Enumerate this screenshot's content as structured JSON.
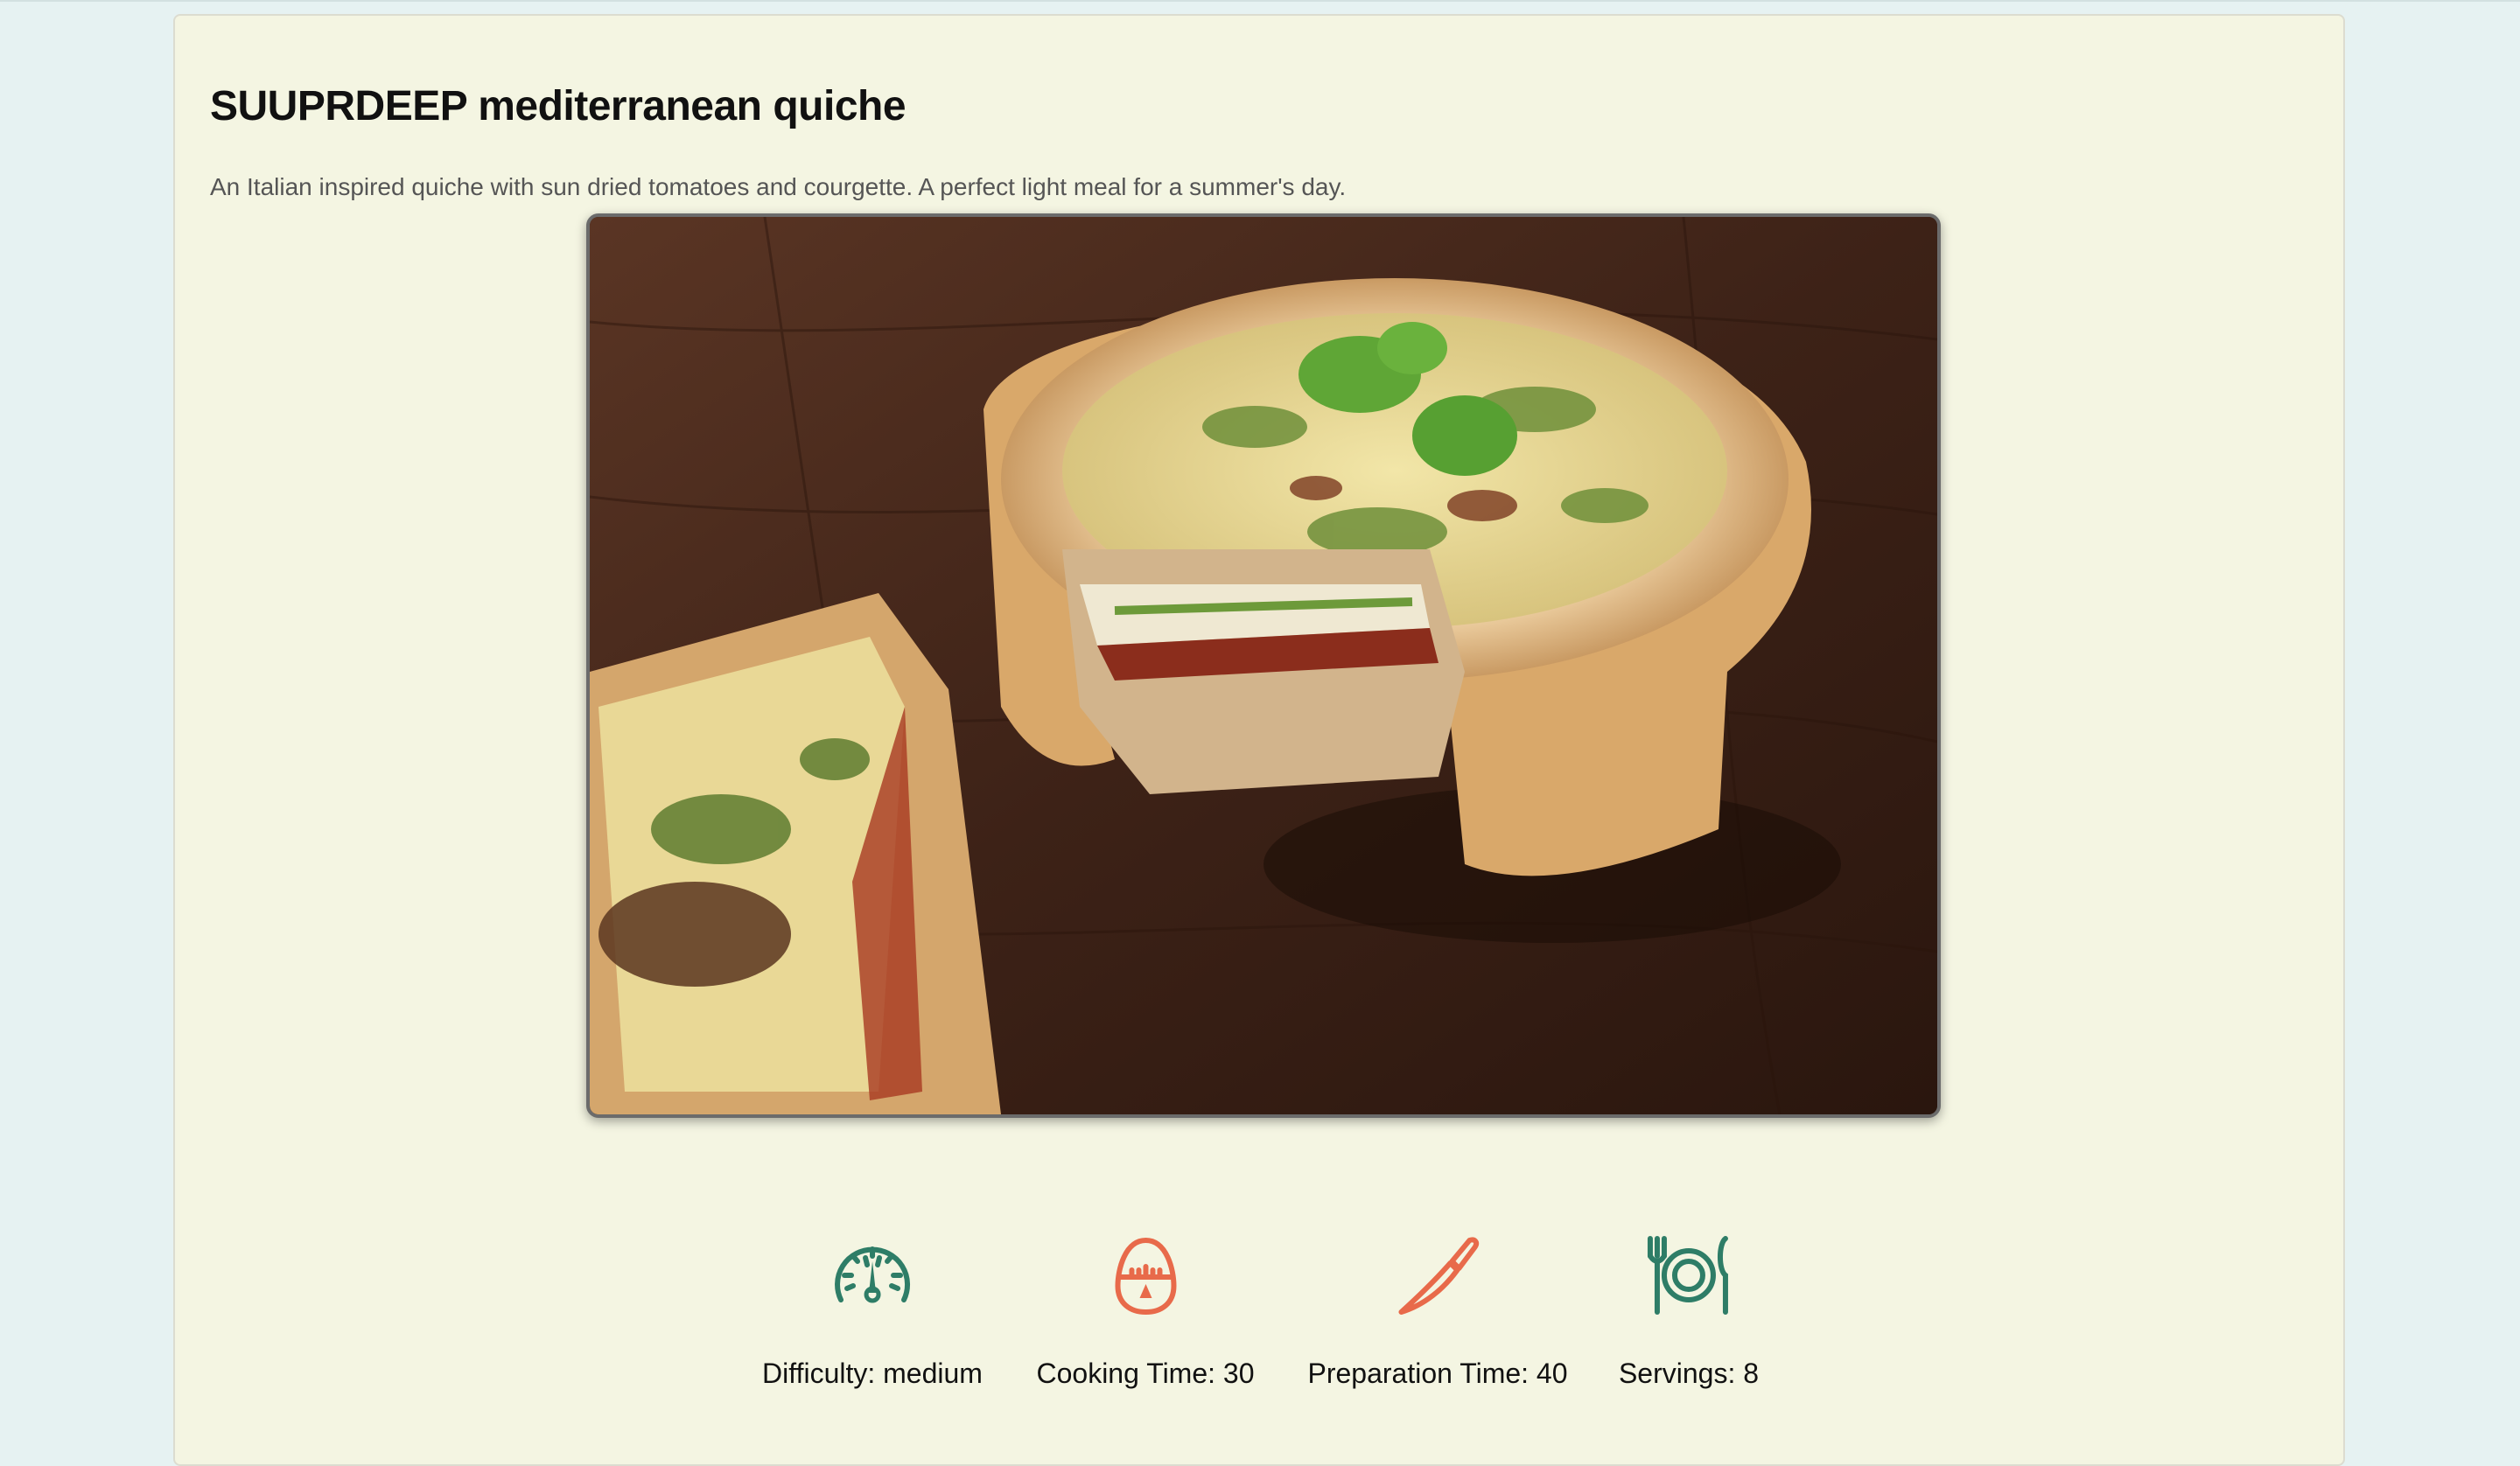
{
  "recipe": {
    "title": "SUUPRDEEP mediterranean quiche",
    "description": "An Italian inspired quiche with sun dried tomatoes and courgette. A perfect light meal for a summer's day.",
    "image": {
      "alt": "mediterranean quiche photo"
    }
  },
  "stats": [
    {
      "icon": "speedometer-icon",
      "label": "Difficulty: medium",
      "color": "#2e7d67"
    },
    {
      "icon": "egg-timer-icon",
      "label": "Cooking Time: 30",
      "color": "#e86a4a"
    },
    {
      "icon": "knife-icon",
      "label": "Preparation Time: 40",
      "color": "#e86a4a"
    },
    {
      "icon": "plate-cutlery-icon",
      "label": "Servings: 8",
      "color": "#2e7d67"
    }
  ],
  "colors": {
    "background": "#e6f2f2",
    "card": "#f4f5e2",
    "green": "#2e7d67",
    "orange": "#e86a4a"
  }
}
